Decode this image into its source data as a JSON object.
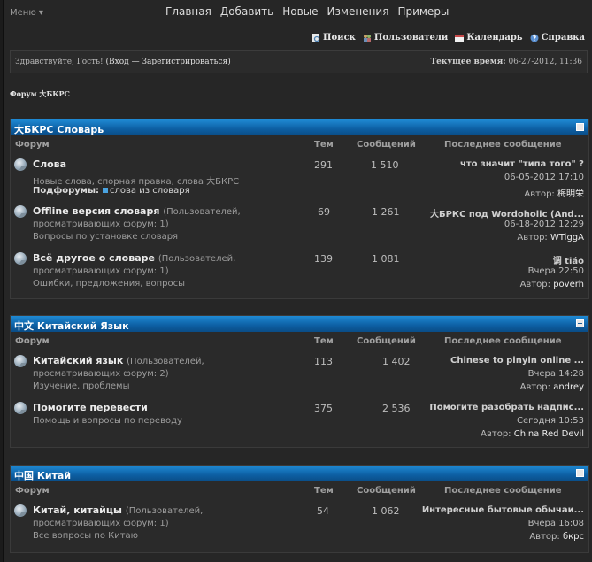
{
  "topbar": {
    "menu_label": "Меню ▾",
    "nav": [
      "Главная",
      "Добавить",
      "Новые",
      "Изменения",
      "Примеры"
    ]
  },
  "toolbar": {
    "search": "Поиск",
    "users": "Пользователи",
    "calendar": "Календарь",
    "help": "Справка"
  },
  "welcome": {
    "greeting": "Здравствуйте, Гость!",
    "auth": "(Вход — Зарегистрироваться)",
    "time_label": "Текущее время:",
    "time_value": "06-27-2012, 11:36"
  },
  "breadcrumb": "Форум 大БКРС",
  "columns": {
    "forum": "Форум",
    "threads": "Тем",
    "posts": "Сообщений",
    "last": "Последнее сообщение"
  },
  "categories": [
    {
      "title": "大БКРС Словарь",
      "forums": [
        {
          "title": "Слова",
          "viewers": "",
          "desc": "Новые слова, спорная правка, слова 大БКРС",
          "subforums_label": "Подфорумы:",
          "subforum": "слова из словаря",
          "threads": "291",
          "posts": "1 510",
          "last_title": "что значит \"типа того\" ?",
          "last_date": "06-05-2012 17:10",
          "author_label": "Автор:",
          "author": "梅明栄"
        },
        {
          "title": "Offline версия словаря",
          "viewers_a": "(Пользователей,",
          "viewers_b": "просматривающих форум: 1)",
          "desc": "Вопросы по установке словаря",
          "threads": "69",
          "posts": "1 261",
          "last_title": "大БРКС под Wordoholic (And...",
          "last_date": "06-18-2012 12:29",
          "author_label": "Автор:",
          "author": "WTiggA"
        },
        {
          "title": "Всё другое о словаре",
          "viewers_a": "(Пользователей,",
          "viewers_b": "просматривающих форум: 1)",
          "desc": "Ошибки, предложения, вопросы",
          "threads": "139",
          "posts": "1 081",
          "last_title": "调 tiáo",
          "last_date": "Вчера 22:50",
          "author_label": "Автор:",
          "author": "poverh"
        }
      ]
    },
    {
      "title": "中文 Китайский Язык",
      "forums": [
        {
          "title": "Китайский язык",
          "viewers_a": "(Пользователей,",
          "viewers_b": "просматривающих форум: 2)",
          "desc": "Изучение, проблемы",
          "threads": "113",
          "posts": "1 402",
          "last_title": "Chinese to pinyin online ...",
          "last_date": "Вчера 14:28",
          "author_label": "Автор:",
          "author": "andrey"
        },
        {
          "title": "Помогите перевести",
          "desc": "Помощь и вопросы по переводу",
          "threads": "375",
          "posts": "2 536",
          "last_title": "Помогите разобрать надпис...",
          "last_date": "Сегодня 10:53",
          "author_label": "Автор:",
          "author": "China Red Devil"
        }
      ]
    },
    {
      "title": "中国 Китай",
      "forums": [
        {
          "title": "Китай, китайцы",
          "viewers_a": "(Пользователей,",
          "viewers_b": "просматривающих форум: 1)",
          "desc": "Все вопросы по Китаю",
          "threads": "54",
          "posts": "1 062",
          "last_title": "Интересные бытовые обычаи...",
          "last_date": "Вчера 16:08",
          "author_label": "Автор:",
          "author": "бкрс"
        }
      ]
    }
  ]
}
